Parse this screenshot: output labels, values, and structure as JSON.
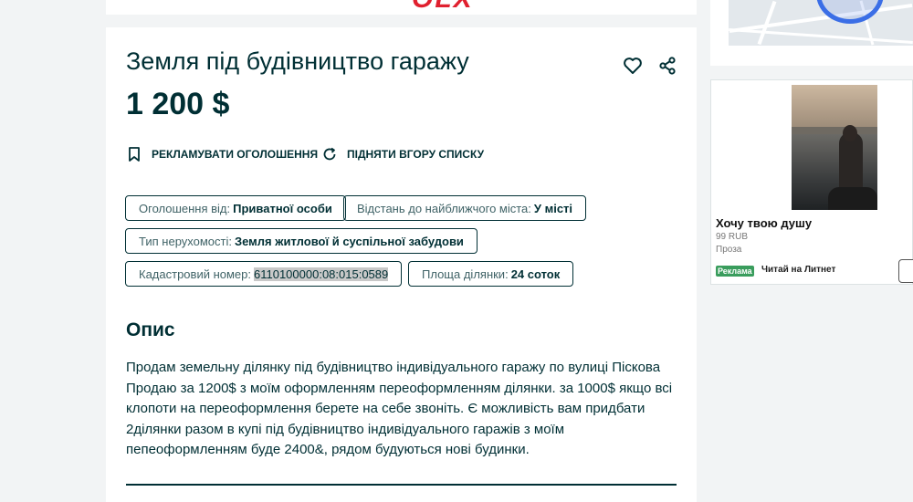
{
  "header": {
    "logo_text": "OLX"
  },
  "listing": {
    "title": "Земля під будівництво гаражу",
    "price": "1 200 $",
    "actions": {
      "promote": "РЕКЛАМУВАТИ ОГОЛОШЕННЯ",
      "raise": "ПІДНЯТИ ВГОРУ СПИСКУ"
    },
    "params": [
      {
        "label": "Оголошення від:",
        "value": "Приватної особи"
      },
      {
        "label": "Відстань до найближчого міста:",
        "value": "У місті"
      },
      {
        "label": "Тип нерухомості:",
        "value": "Земля житлової й суспільної забудови"
      },
      {
        "label": "Кадастровий номер:",
        "value": "6110100000:08:015:0589"
      },
      {
        "label": "Площа ділянки:",
        "value": "24 соток"
      }
    ],
    "description_title": "Опис",
    "description_lines": [
      "Продам земельну ділянку під будівництво індивідуального гаражу по вулиці Піскова",
      "Продаю за 1200$ з моїм оформленням переоформленням ділянки. за 1000$ якщо всі",
      "клопоти на переоформлення берете на себе звоніть. Є можливість вам придбати",
      "2ділянки разом в купі під будівництво індивідуального гаражів з моїм",
      "пепеоформленням буде 2400&, рядом будуються нові будинки."
    ]
  },
  "ad": {
    "title": "Хочу твою душу",
    "price": "99 RUB",
    "category": "Проза",
    "badge": "Реклама",
    "link": "Читай на Литнет"
  },
  "colors": {
    "text": "#002f34",
    "background": "#f2f4f5",
    "logo": "#e0202f",
    "ad_badge": "#3a9d5d"
  },
  "icons": [
    "heart-icon",
    "share-icon",
    "bookmark-icon",
    "refresh-icon"
  ]
}
